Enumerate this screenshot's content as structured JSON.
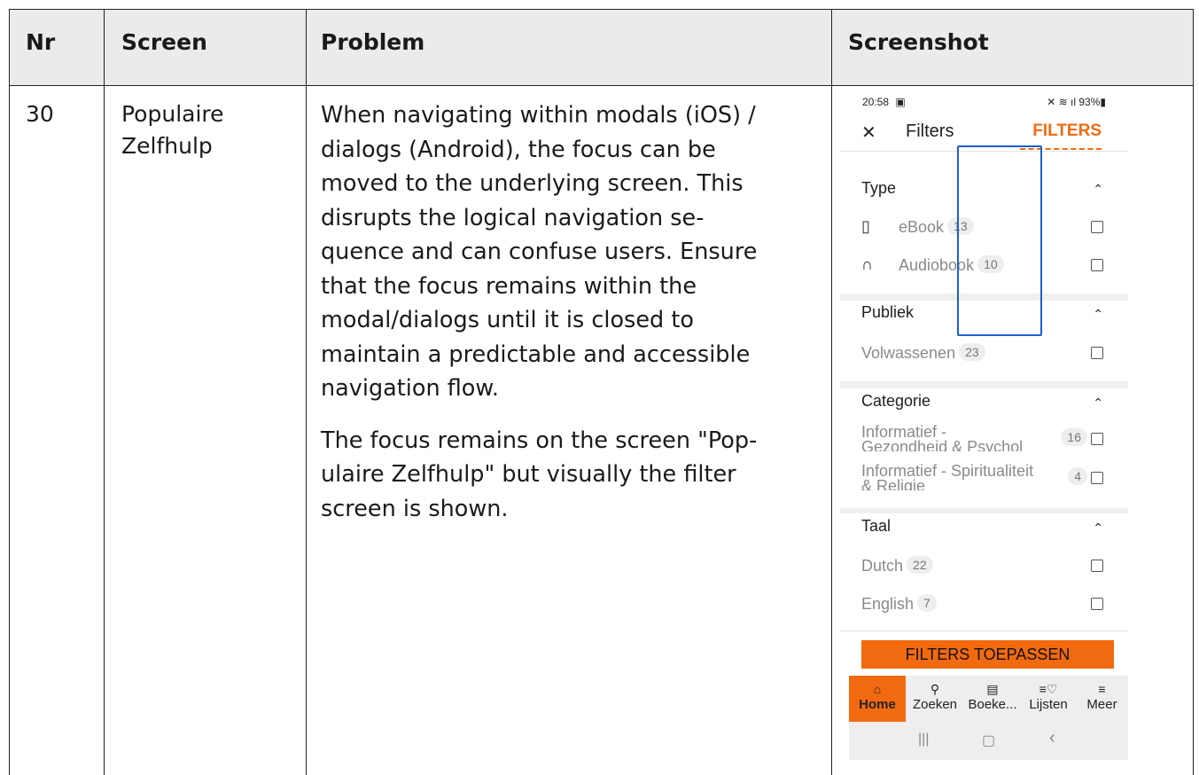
{
  "header": {
    "nr": "Nr",
    "screen": "Screen",
    "problem": "Problem",
    "screenshot": "Screenshot"
  },
  "row": {
    "nr": "30",
    "screen_line1": "Populaire",
    "screen_line2": "Zelfhulp",
    "problem_lines_1": [
      "When navigating within modals (iOS) /",
      "dialogs (Android), the focus can be",
      "moved to the underlying screen. This",
      "disrupts the logical navigation se-",
      "quence and can confuse users. Ensure",
      "that the focus remains within the",
      "modal/dialogs until it is closed to",
      "maintain a predictable and accessible",
      "navigation flow."
    ],
    "problem_lines_2": [
      "The focus remains on the screen \"Pop-",
      "ulaire Zelfhulp\" but visually the filter",
      "screen is shown."
    ]
  },
  "phone": {
    "status_time": "20:58",
    "status_battery": "93%",
    "close_icon": "close-icon",
    "title": "Filters",
    "reset_label": "FILTERS",
    "sections": {
      "type": {
        "title": "Type",
        "options": [
          {
            "label": "eBook",
            "count": "13",
            "icon": "ebook-icon"
          },
          {
            "label": "Audiobook",
            "count": "10",
            "icon": "headphones-icon"
          }
        ]
      },
      "publiek": {
        "title": "Publiek",
        "options": [
          {
            "label": "Volwassenen",
            "count": "23"
          }
        ]
      },
      "categorie": {
        "title": "Categorie",
        "options": [
          {
            "label": "Informatief -",
            "label2": "Gezondheid & Psychol",
            "count": "16"
          },
          {
            "label": "Informatief - Spiritualiteit",
            "label2": "& Religie",
            "count": "4"
          }
        ]
      },
      "taal": {
        "title": "Taal",
        "options": [
          {
            "label": "Dutch",
            "count": "22"
          },
          {
            "label": "English",
            "count": "7"
          }
        ]
      }
    },
    "apply_label": "FILTERS TOEPASSEN",
    "nav": [
      {
        "label": "Home",
        "icon": "home-icon"
      },
      {
        "label": "Zoeken",
        "icon": "search-icon"
      },
      {
        "label": "Boeke...",
        "icon": "book-icon"
      },
      {
        "label": "Lijsten",
        "icon": "list-heart-icon"
      },
      {
        "label": "Meer",
        "icon": "menu-icon"
      }
    ],
    "sys_recent": "|||",
    "sys_home": "▢",
    "sys_back": "‹",
    "colors": {
      "accent": "#f26a10",
      "focus": "#1f5fd1"
    }
  }
}
